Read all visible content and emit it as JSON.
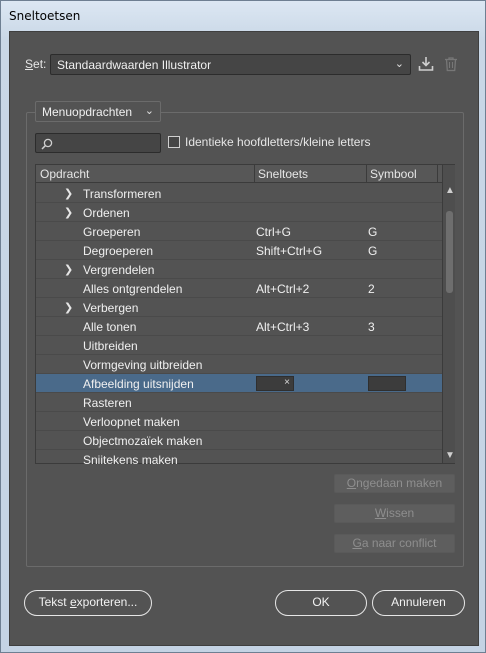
{
  "window": {
    "title": "Sneltoetsen"
  },
  "set": {
    "label": "Set:",
    "value": "Standaardwaarden Illustrator"
  },
  "menu_dropdown": {
    "value": "Menuopdrachten"
  },
  "search": {
    "placeholder": ""
  },
  "match_case": {
    "label": "Identieke hoofdletters/kleine letters",
    "checked": false
  },
  "table": {
    "headers": {
      "command": "Opdracht",
      "shortcut": "Sneltoets",
      "symbol": "Symbool"
    },
    "rows": [
      {
        "expandable": true,
        "name": "Transformeren",
        "shortcut": "",
        "symbol": ""
      },
      {
        "expandable": true,
        "name": "Ordenen",
        "shortcut": "",
        "symbol": ""
      },
      {
        "expandable": false,
        "name": "Groeperen",
        "shortcut": "Ctrl+G",
        "symbol": "G"
      },
      {
        "expandable": false,
        "name": "Degroeperen",
        "shortcut": "Shift+Ctrl+G",
        "symbol": "G"
      },
      {
        "expandable": true,
        "name": "Vergrendelen",
        "shortcut": "",
        "symbol": ""
      },
      {
        "expandable": false,
        "name": "Alles ontgrendelen",
        "shortcut": "Alt+Ctrl+2",
        "symbol": "2"
      },
      {
        "expandable": true,
        "name": "Verbergen",
        "shortcut": "",
        "symbol": ""
      },
      {
        "expandable": false,
        "name": "Alle tonen",
        "shortcut": "Alt+Ctrl+3",
        "symbol": "3"
      },
      {
        "expandable": false,
        "name": "Uitbreiden",
        "shortcut": "",
        "symbol": ""
      },
      {
        "expandable": false,
        "name": "Vormgeving uitbreiden",
        "shortcut": "",
        "symbol": ""
      },
      {
        "expandable": false,
        "name": "Afbeelding uitsnijden",
        "shortcut": "",
        "symbol": "",
        "selected": true
      },
      {
        "expandable": false,
        "name": "Rasteren",
        "shortcut": "",
        "symbol": ""
      },
      {
        "expandable": false,
        "name": "Verloopnet maken",
        "shortcut": "",
        "symbol": ""
      },
      {
        "expandable": false,
        "name": "Objectmozaïek maken",
        "shortcut": "",
        "symbol": ""
      },
      {
        "expandable": false,
        "name": "Snijtekens maken",
        "shortcut": "",
        "symbol": ""
      }
    ]
  },
  "side_buttons": {
    "undo": "Ongedaan maken",
    "clear": "Wissen",
    "goto_conflict": "Ga naar conflict"
  },
  "footer": {
    "export": "Tekst exporteren...",
    "ok": "OK",
    "cancel": "Annuleren"
  },
  "colors": {
    "dialog_bg": "#535353",
    "selection": "#4a6a8a"
  }
}
